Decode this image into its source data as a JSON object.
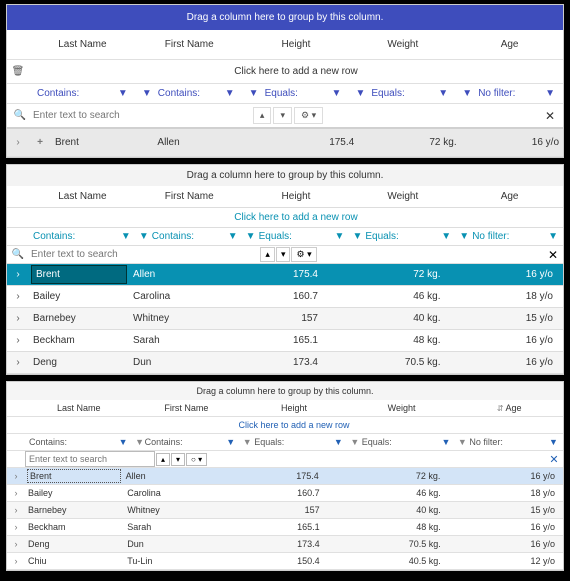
{
  "shared": {
    "group_hint": "Drag a column here to group by this column.",
    "add_row_hint": "Click here to add a new row",
    "search_placeholder": "Enter text to search",
    "columns": {
      "last_name": "Last Name",
      "first_name": "First Name",
      "height": "Height",
      "weight": "Weight",
      "age": "Age"
    },
    "filters": {
      "contains": "Contains:",
      "equals": "Equals:",
      "no_filter": "No filter:"
    },
    "icons": {
      "trash": "🗑",
      "search": "🔍",
      "filter": "▼",
      "chevron_right": "›",
      "chevron_down": "▾",
      "chevron_up": "▴",
      "plus": "+",
      "gear": "⚙",
      "circle": "○",
      "close": "✕",
      "sort": "⇵"
    }
  },
  "grid1": {
    "rows": [
      {
        "last_name": "Brent",
        "first_name": "Allen",
        "height": "175.4",
        "weight": "72 kg.",
        "age": "16 y/o"
      }
    ]
  },
  "grid2": {
    "rows": [
      {
        "last_name": "Brent",
        "first_name": "Allen",
        "height": "175.4",
        "weight": "72 kg.",
        "age": "16 y/o"
      },
      {
        "last_name": "Bailey",
        "first_name": "Carolina",
        "height": "160.7",
        "weight": "46 kg.",
        "age": "18 y/o"
      },
      {
        "last_name": "Barnebey",
        "first_name": "Whitney",
        "height": "157",
        "weight": "40 kg.",
        "age": "15 y/o"
      },
      {
        "last_name": "Beckham",
        "first_name": "Sarah",
        "height": "165.1",
        "weight": "48 kg.",
        "age": "16 y/o"
      },
      {
        "last_name": "Deng",
        "first_name": "Dun",
        "height": "173.4",
        "weight": "70.5 kg.",
        "age": "16 y/o"
      }
    ]
  },
  "grid3": {
    "rows": [
      {
        "last_name": "Brent",
        "first_name": "Allen",
        "height": "175.4",
        "weight": "72 kg.",
        "age": "16 y/o"
      },
      {
        "last_name": "Bailey",
        "first_name": "Carolina",
        "height": "160.7",
        "weight": "46 kg.",
        "age": "18 y/o"
      },
      {
        "last_name": "Barnebey",
        "first_name": "Whitney",
        "height": "157",
        "weight": "40 kg.",
        "age": "15 y/o"
      },
      {
        "last_name": "Beckham",
        "first_name": "Sarah",
        "height": "165.1",
        "weight": "48 kg.",
        "age": "16 y/o"
      },
      {
        "last_name": "Deng",
        "first_name": "Dun",
        "height": "173.4",
        "weight": "70.5 kg.",
        "age": "16 y/o"
      },
      {
        "last_name": "Chiu",
        "first_name": "Tu-Lin",
        "height": "150.4",
        "weight": "40.5 kg.",
        "age": "12 y/o"
      }
    ]
  }
}
